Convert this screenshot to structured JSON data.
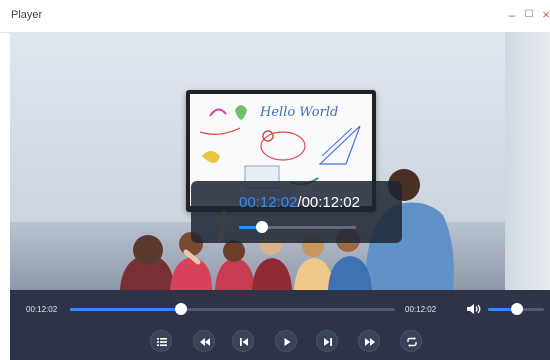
{
  "window": {
    "title": "Player",
    "minimize_glyph": "–",
    "maximize_glyph": "☐",
    "close_glyph": "×"
  },
  "video": {
    "whiteboard_text": "Hello World",
    "overlay": {
      "current_time": "00:12:02",
      "separator": "/",
      "total_time": "00:12:02",
      "progress": 0.2
    }
  },
  "controls": {
    "current_time": "00:12:02",
    "total_time": "00:12:02",
    "seek_progress": 0.34,
    "volume_level": 0.52,
    "accent_color": "#2f8cff",
    "buttons": [
      {
        "name": "playlist-icon"
      },
      {
        "name": "rewind-icon"
      },
      {
        "name": "previous-icon"
      },
      {
        "name": "play-icon"
      },
      {
        "name": "next-icon"
      },
      {
        "name": "fast-forward-icon"
      },
      {
        "name": "repeat-icon"
      }
    ]
  }
}
